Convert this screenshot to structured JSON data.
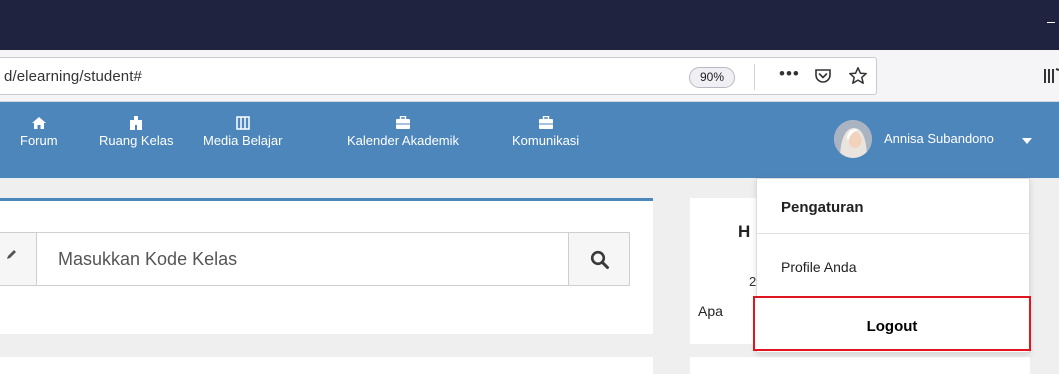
{
  "browser": {
    "url": "d/elearning/student#",
    "zoom": "90%",
    "page_actions": "•••"
  },
  "navbar": {
    "items": [
      {
        "label": "Forum",
        "icon": "home-icon"
      },
      {
        "label": "Ruang Kelas",
        "icon": "building-icon"
      },
      {
        "label": "Media Belajar",
        "icon": "book-icon"
      },
      {
        "label": "Kalender Akademik",
        "icon": "briefcase-icon"
      },
      {
        "label": "Komunikasi",
        "icon": "briefcase-icon"
      }
    ],
    "user_name": "Annisa Subandono"
  },
  "class_code": {
    "placeholder": "Masukkan Kode Kelas"
  },
  "side_card": {
    "heading": "H",
    "number": "2",
    "text": "Apa"
  },
  "user_menu": {
    "settings": "Pengaturan",
    "profile": "Profile Anda",
    "logout": "Logout"
  },
  "colors": {
    "title_bar": "#1f2340",
    "navbar": "#4d86bb",
    "highlight": "#e0161e"
  }
}
